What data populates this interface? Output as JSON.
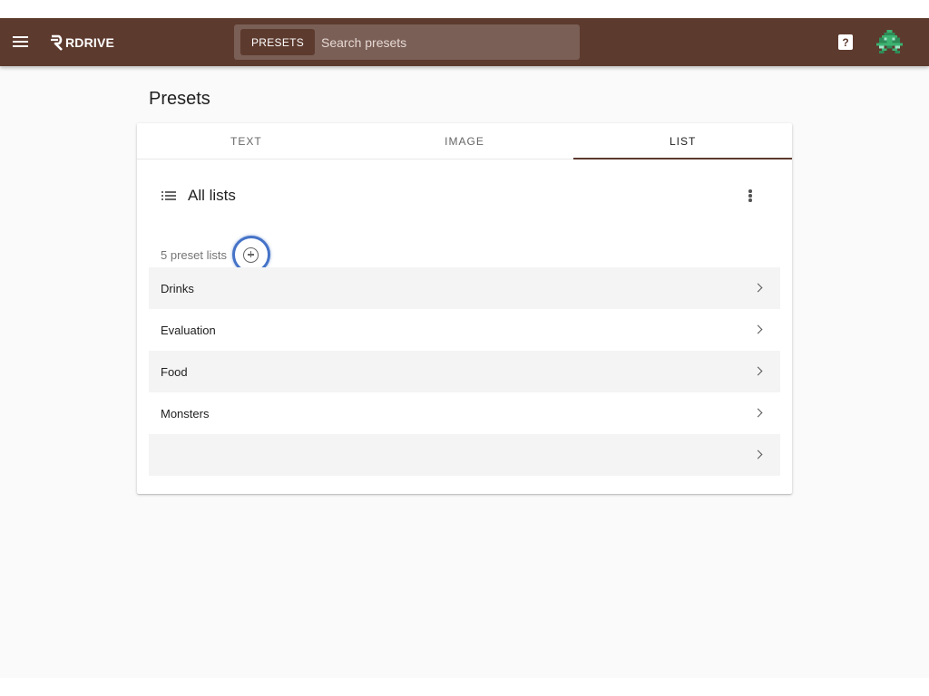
{
  "app": {
    "logo_text": "RDRIVE"
  },
  "search": {
    "chip_label": "PRESETS",
    "placeholder": "Search presets",
    "value": ""
  },
  "header": {
    "help_label": "?"
  },
  "page": {
    "title": "Presets"
  },
  "tabs": [
    {
      "label": "TEXT",
      "active": false
    },
    {
      "label": "IMAGE",
      "active": false
    },
    {
      "label": "LIST",
      "active": true
    }
  ],
  "list_section": {
    "title": "All lists",
    "count_text": "5 preset lists",
    "items": [
      {
        "label": "Drinks"
      },
      {
        "label": "Evaluation"
      },
      {
        "label": "Food"
      },
      {
        "label": "Monsters"
      },
      {
        "label": ""
      }
    ]
  },
  "colors": {
    "brand": "#5d3a2e",
    "focus_ring": "#4573c7"
  },
  "icons": [
    "menu-icon",
    "logo-icon",
    "help-icon",
    "avatar",
    "list-icon",
    "more-vert-icon",
    "add-circle-icon",
    "chevron-right-icon"
  ]
}
